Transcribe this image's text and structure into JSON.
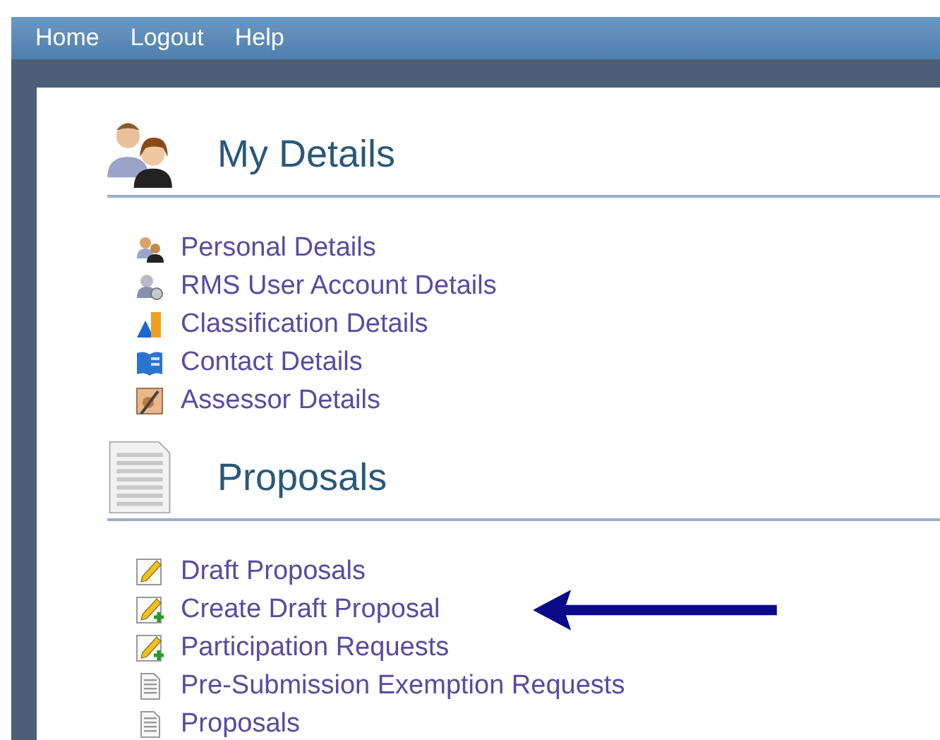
{
  "nav": [
    "Home",
    "Logout",
    "Help"
  ],
  "sections": [
    {
      "title": "My Details",
      "kind": "people",
      "items": [
        {
          "label": "Personal Details",
          "kind": "people",
          "pointed": false
        },
        {
          "label": "RMS User Account Details",
          "kind": "user-gear",
          "pointed": false
        },
        {
          "label": "Classification Details",
          "kind": "shapes",
          "pointed": false
        },
        {
          "label": "Contact Details",
          "kind": "book",
          "pointed": false
        },
        {
          "label": "Assessor Details",
          "kind": "assessor",
          "pointed": false
        }
      ]
    },
    {
      "title": "Proposals",
      "kind": "document",
      "items": [
        {
          "label": "Draft Proposals",
          "kind": "pencil",
          "pointed": false
        },
        {
          "label": "Create Draft Proposal",
          "kind": "pencil-plus",
          "pointed": true
        },
        {
          "label": "Participation Requests",
          "kind": "pencil-plus",
          "pointed": false
        },
        {
          "label": "Pre-Submission Exemption Requests",
          "kind": "page",
          "pointed": false
        },
        {
          "label": "Proposals",
          "kind": "page",
          "pointed": false
        }
      ]
    }
  ]
}
